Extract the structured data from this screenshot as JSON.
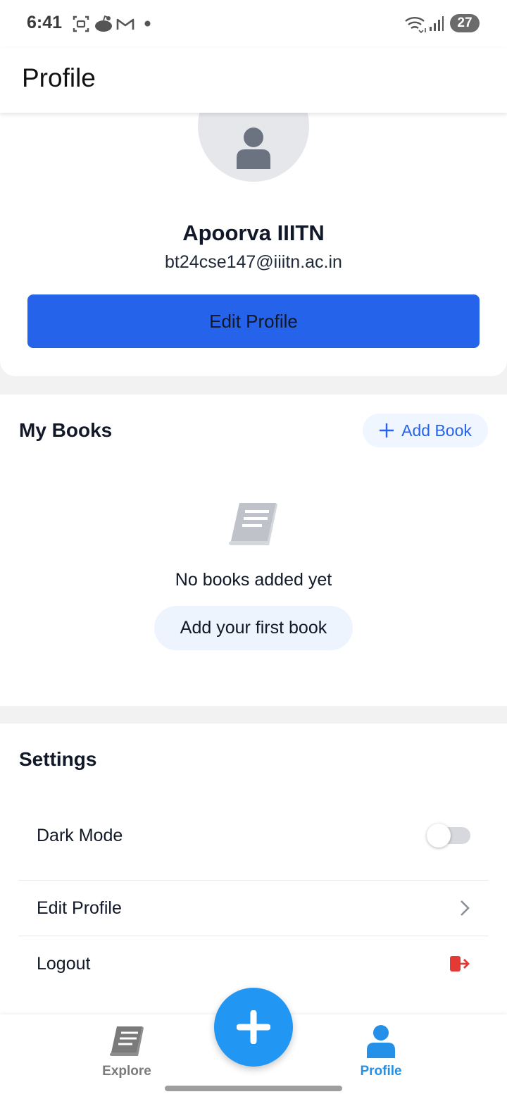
{
  "status_bar": {
    "time": "6:41",
    "battery": "27",
    "icons": [
      "screenshot-icon",
      "reddit-icon",
      "gmail-icon",
      "notification-dot-icon",
      "wifi-icon",
      "signal-icon",
      "battery-icon"
    ]
  },
  "header": {
    "title": "Profile"
  },
  "profile": {
    "name": "Apoorva IIITN",
    "email": "bt24cse147@iiitn.ac.in",
    "edit_button": "Edit Profile"
  },
  "books": {
    "title": "My Books",
    "add_button": "Add Book",
    "empty_text": "No books added yet",
    "first_book_button": "Add your first book"
  },
  "settings": {
    "title": "Settings",
    "dark_mode": {
      "label": "Dark Mode",
      "enabled": false
    },
    "edit_profile": "Edit Profile",
    "logout": "Logout"
  },
  "nav": {
    "explore": "Explore",
    "profile": "Profile",
    "active": "profile"
  },
  "colors": {
    "primary": "#2563eb",
    "fab": "#2196f3",
    "nav_active": "#2590e8",
    "logout_icon": "#e53935"
  }
}
